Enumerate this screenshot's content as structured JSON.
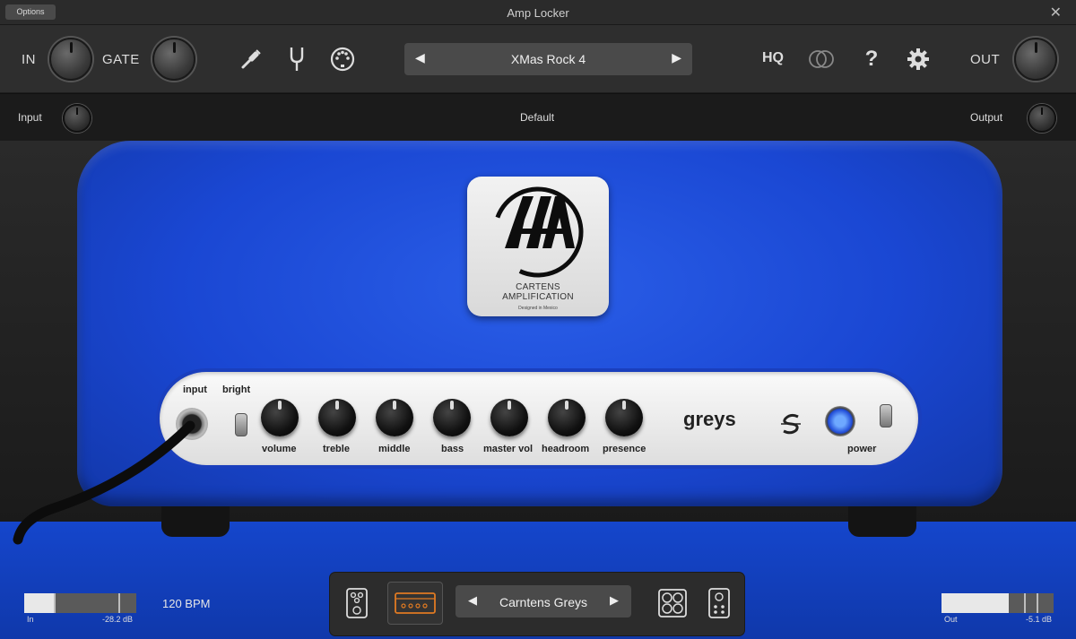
{
  "window": {
    "title": "Amp Locker",
    "options_label": "Options",
    "close_glyph": "✕"
  },
  "toolbar": {
    "in_label": "IN",
    "gate_label": "GATE",
    "preset_prev": "◀",
    "preset_next": "▶",
    "preset_name": "XMas Rock 4",
    "hq_label": "HQ",
    "help_glyph": "?",
    "out_label": "OUT",
    "icons": [
      "guitar-cable-icon",
      "tuning-fork-icon",
      "midi-icon",
      "stereo-icon",
      "help-icon",
      "gear-icon"
    ]
  },
  "subbar": {
    "input_label": "Input",
    "center_label": "Default",
    "output_label": "Output"
  },
  "amp": {
    "badge_line1": "CARTENS",
    "badge_line2": "AMPLIFICATION",
    "badge_line3": "Designed in Mexico",
    "brand": "greys",
    "labels": {
      "input": "input",
      "bright": "bright",
      "volume": "volume",
      "treble": "treble",
      "middle": "middle",
      "bass": "bass",
      "master": "master vol",
      "headroom": "headroom",
      "presence": "presence",
      "power": "power"
    },
    "colors": {
      "tolex": "#1a47d3",
      "panel": "#e8e8e8",
      "led": "#3b7bff"
    }
  },
  "bottom": {
    "in_meter_label": "In",
    "in_meter_value": "-28.2 dB",
    "in_meter_level": 0.27,
    "out_meter_label": "Out",
    "out_meter_value": "-5.1 dB",
    "out_meter_level": 0.6,
    "bpm": "120 BPM",
    "amp_prev": "◀",
    "amp_next": "▶",
    "amp_name": "Carntens Greys"
  }
}
